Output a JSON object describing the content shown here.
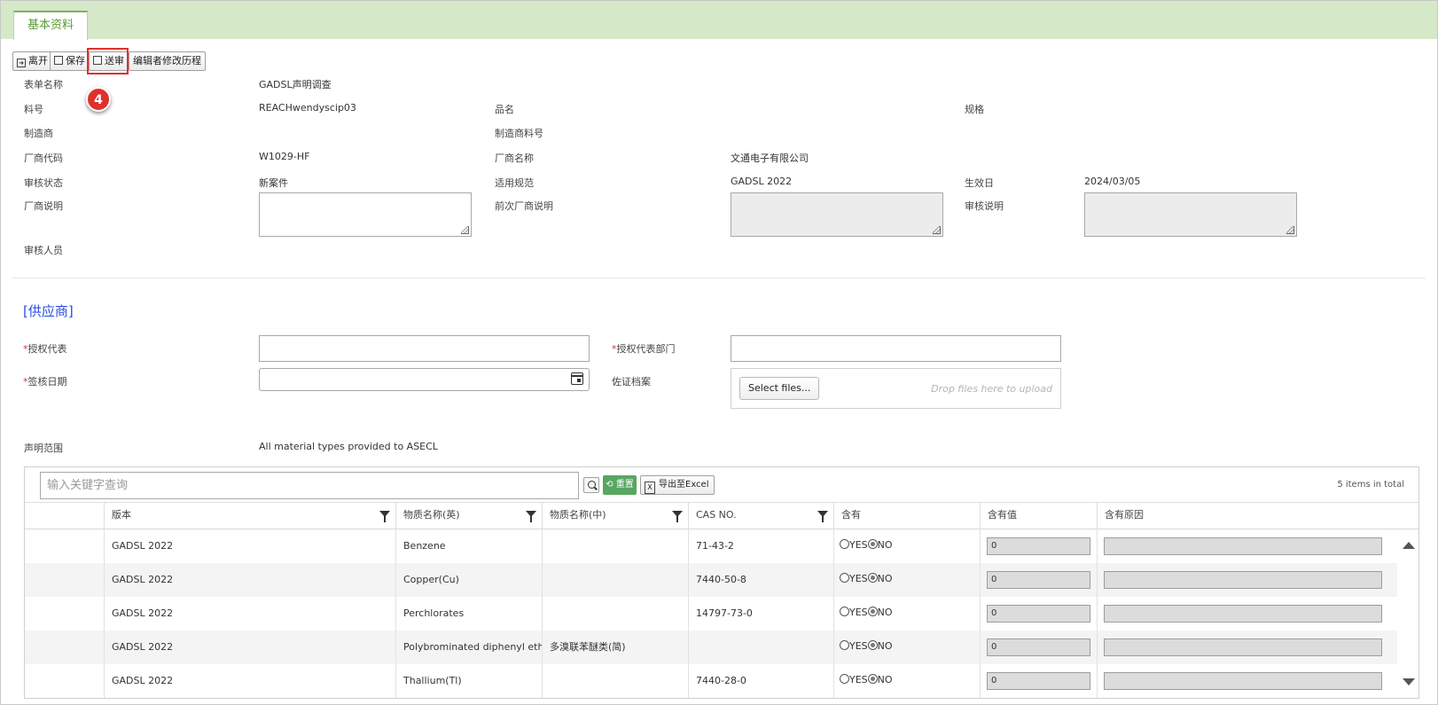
{
  "tab": {
    "label": "基本资料"
  },
  "toolbar": {
    "leave": "离开",
    "save": "保存",
    "submit": "送审",
    "history": "编辑者修改历程"
  },
  "annotation": {
    "step": "4"
  },
  "form": {
    "form_name_label": "表单名称",
    "form_name_value": "GADSL声明调查",
    "part_no_label": "料号",
    "part_no_value": "REACHwendyscip03",
    "product_name_label": "品名",
    "spec_label": "规格",
    "manufacturer_label": "制造商",
    "mfr_part_no_label": "制造商料号",
    "vendor_code_label": "厂商代码",
    "vendor_code_value": "W1029-HF",
    "vendor_name_label": "厂商名称",
    "vendor_name_value": "文通电子有限公司",
    "review_status_label": "审核状态",
    "review_status_value": "新案件",
    "applicable_spec_label": "适用规范",
    "applicable_spec_value": "GADSL 2022",
    "effective_date_label": "生效日",
    "effective_date_value": "2024/03/05",
    "vendor_desc_label": "厂商说明",
    "prev_vendor_desc_label": "前次厂商说明",
    "review_desc_label": "审核说明",
    "reviewer_label": "审核人员"
  },
  "supplier": {
    "section_title": "[供应商]",
    "required_mark": "*",
    "auth_rep_label": "授权代表",
    "auth_rep_dept_label": "授权代表部门",
    "sign_date_label": "签核日期",
    "evidence_label": "佐证档案",
    "select_files": "Select files...",
    "drop_hint": "Drop files here to upload",
    "declare_scope_label": "声明范围",
    "declare_scope_value": "All material types provided to ASECL"
  },
  "grid": {
    "search_placeholder": "输入关键字查询",
    "reset_label": "重置",
    "export_label": "导出至Excel",
    "total": "5 items in total",
    "columns": [
      "版本",
      "物质名称(英)",
      "物质名称(中)",
      "CAS NO.",
      "含有",
      "含有值",
      "含有原因"
    ],
    "yes": "YES",
    "no": "NO",
    "rows": [
      {
        "version": "GADSL 2022",
        "name_en": "Benzene",
        "name_cn": "",
        "cas": "71-43-2",
        "value": "0"
      },
      {
        "version": "GADSL 2022",
        "name_en": "Copper(Cu)",
        "name_cn": "",
        "cas": "7440-50-8",
        "value": "0"
      },
      {
        "version": "GADSL 2022",
        "name_en": "Perchlorates",
        "name_cn": "",
        "cas": "14797-73-0",
        "value": "0"
      },
      {
        "version": "GADSL 2022",
        "name_en": "Polybrominated diphenyl ethers(",
        "name_cn": "多溴联苯醚类(简)",
        "cas": "",
        "value": "0"
      },
      {
        "version": "GADSL 2022",
        "name_en": "Thallium(Tl)",
        "name_cn": "",
        "cas": "7440-28-0",
        "value": "0"
      }
    ]
  }
}
